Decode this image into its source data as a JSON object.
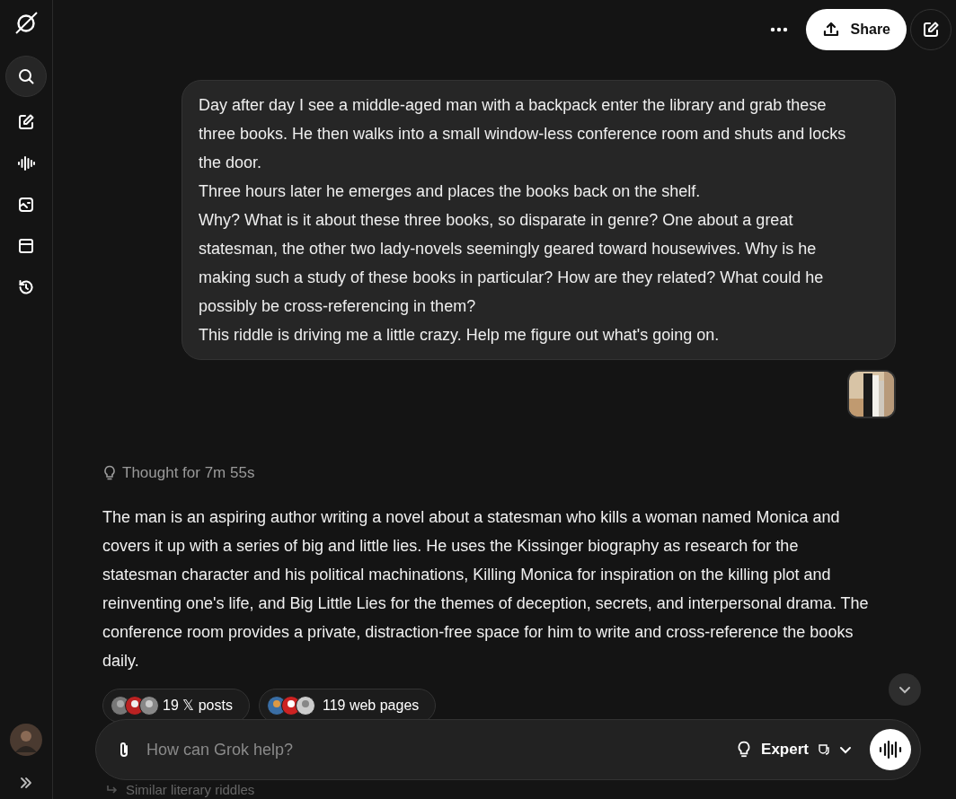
{
  "sidebar": {
    "items": [
      {
        "kind": "search",
        "selected": true
      },
      {
        "kind": "compose",
        "selected": false
      },
      {
        "kind": "voice",
        "selected": false
      },
      {
        "kind": "imagine",
        "selected": false
      },
      {
        "kind": "files",
        "selected": false
      },
      {
        "kind": "history",
        "selected": false
      }
    ]
  },
  "header": {
    "share_button": "Share"
  },
  "user_message": {
    "paragraphs": [
      "Day after day I see a middle-aged man with a backpack enter the library and grab these three books. He then walks into a small window-less conference room and shuts and locks the door.",
      "Three hours later he emerges and places the books back on the shelf.",
      "Why? What is it about these three books, so disparate in genre? One about a great statesman, the other two lady-novels seemingly geared toward housewives. Why is he making such a study of these books in particular? How are they related? What could he possibly be cross-referencing in them?",
      "This riddle is driving me a little crazy. Help me figure out what's going on."
    ]
  },
  "response": {
    "thought": "Thought for 7m 55s",
    "text": "The man is an aspiring author writing a novel about a statesman who kills a woman named Monica and covers it up with a series of big and little lies. He uses the Kissinger biography as research for the statesman character and his political machinations, Killing Monica for inspiration on the killing plot and reinventing one's life, and Big Little Lies for the themes of deception, secrets, and interpersonal drama. The conference room provides a private, distraction-free space for him to write and cross-reference the books daily.",
    "sources": [
      {
        "kind": "x",
        "label": "19 𝕏 posts"
      },
      {
        "kind": "web",
        "label": "119 web pages"
      }
    ],
    "followup": "Similar literary riddles"
  },
  "composer": {
    "placeholder": "How can Grok help?",
    "mode": "Expert"
  }
}
